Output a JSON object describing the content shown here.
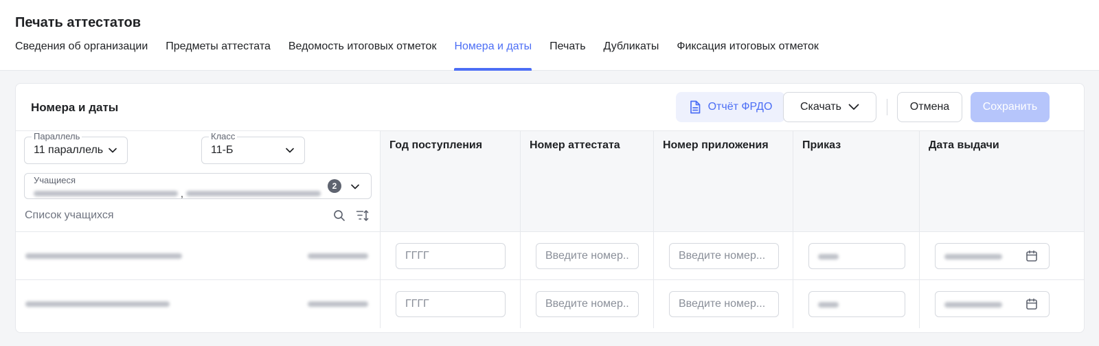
{
  "page": {
    "title": "Печать аттестатов"
  },
  "tabs": [
    {
      "label": "Сведения об организации",
      "active": false
    },
    {
      "label": "Предметы аттестата",
      "active": false
    },
    {
      "label": "Ведомость итоговых отметок",
      "active": false
    },
    {
      "label": "Номера и даты",
      "active": true
    },
    {
      "label": "Печать",
      "active": false
    },
    {
      "label": "Дубликаты",
      "active": false
    },
    {
      "label": "Фиксация итоговых отметок",
      "active": false
    }
  ],
  "card": {
    "title": "Номера и даты",
    "buttons": {
      "report": "Отчёт ФРДО",
      "download": "Скачать",
      "cancel": "Отмена",
      "save": "Сохранить"
    }
  },
  "filters": {
    "parallel": {
      "label": "Параллель",
      "value": "11 параллель"
    },
    "class": {
      "label": "Класс",
      "value": "11-Б"
    },
    "students": {
      "label": "Учащиеся",
      "count": "2",
      "separator": ","
    },
    "list_label": "Список учащихся"
  },
  "columns": {
    "year": "Год поступления",
    "certificate_number": "Номер аттестата",
    "appendix_number": "Номер приложения",
    "order": "Приказ",
    "issue_date": "Дата выдачи"
  },
  "rows": [
    {
      "year_placeholder": "ГГГГ",
      "certificate_placeholder": "Введите номер..",
      "appendix_placeholder": "Введите номер..."
    },
    {
      "year_placeholder": "ГГГГ",
      "certificate_placeholder": "Введите номер..",
      "appendix_placeholder": "Введите номер..."
    }
  ],
  "colors": {
    "accent": "#4c6ef5",
    "accent_soft": "#eef1fd",
    "save_disabled": "#b6c5fb",
    "border": "#d5d8de"
  },
  "icons": {
    "report": "document-icon",
    "download": "chevron-down-icon",
    "search": "search-icon",
    "sort": "sort-icon",
    "calendar": "calendar-icon"
  }
}
